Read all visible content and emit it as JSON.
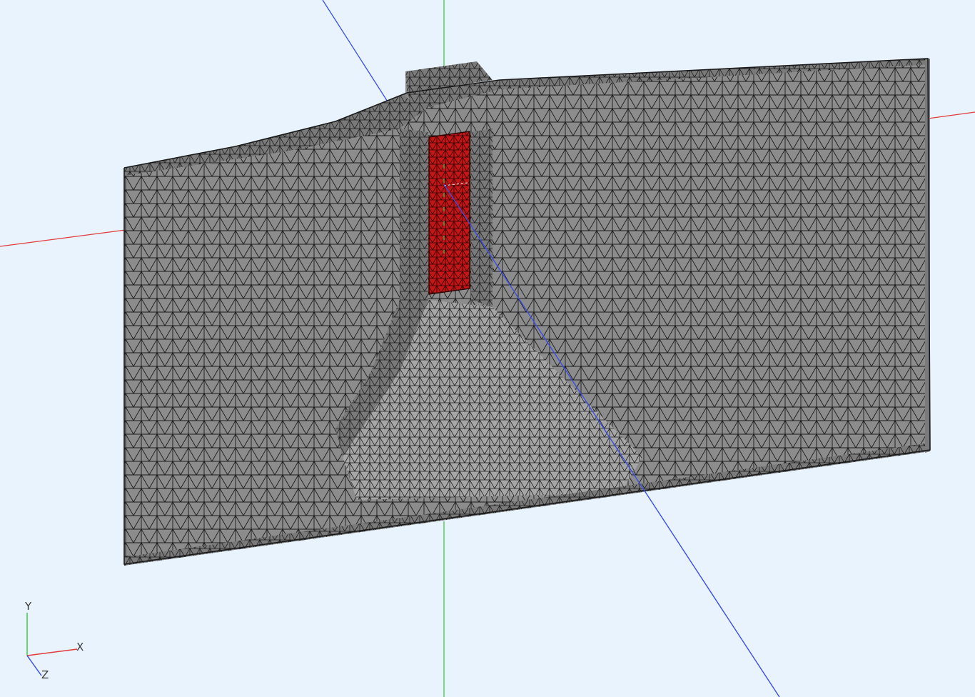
{
  "viewer": {
    "background_color": "#e8f3fe",
    "mesh_fill_color": "#8c8c8c",
    "mesh_face_light": "#a6a6a6",
    "mesh_face_dark": "#7a7a7a",
    "mesh_edge_color": "#1a1a1a",
    "highlight_fill_color": "#c41616",
    "highlight_edge_color": "#2a0000"
  },
  "scene_axes": {
    "x_color": "#e23b3b",
    "y_color": "#3ecf3e",
    "z_color": "#3b4fe2"
  },
  "triad": {
    "x_label": "X",
    "y_label": "Y",
    "z_label": "Z",
    "x_color": "#e23b3b",
    "y_color": "#3ecf3e",
    "z_color": "#3b4fe2"
  }
}
